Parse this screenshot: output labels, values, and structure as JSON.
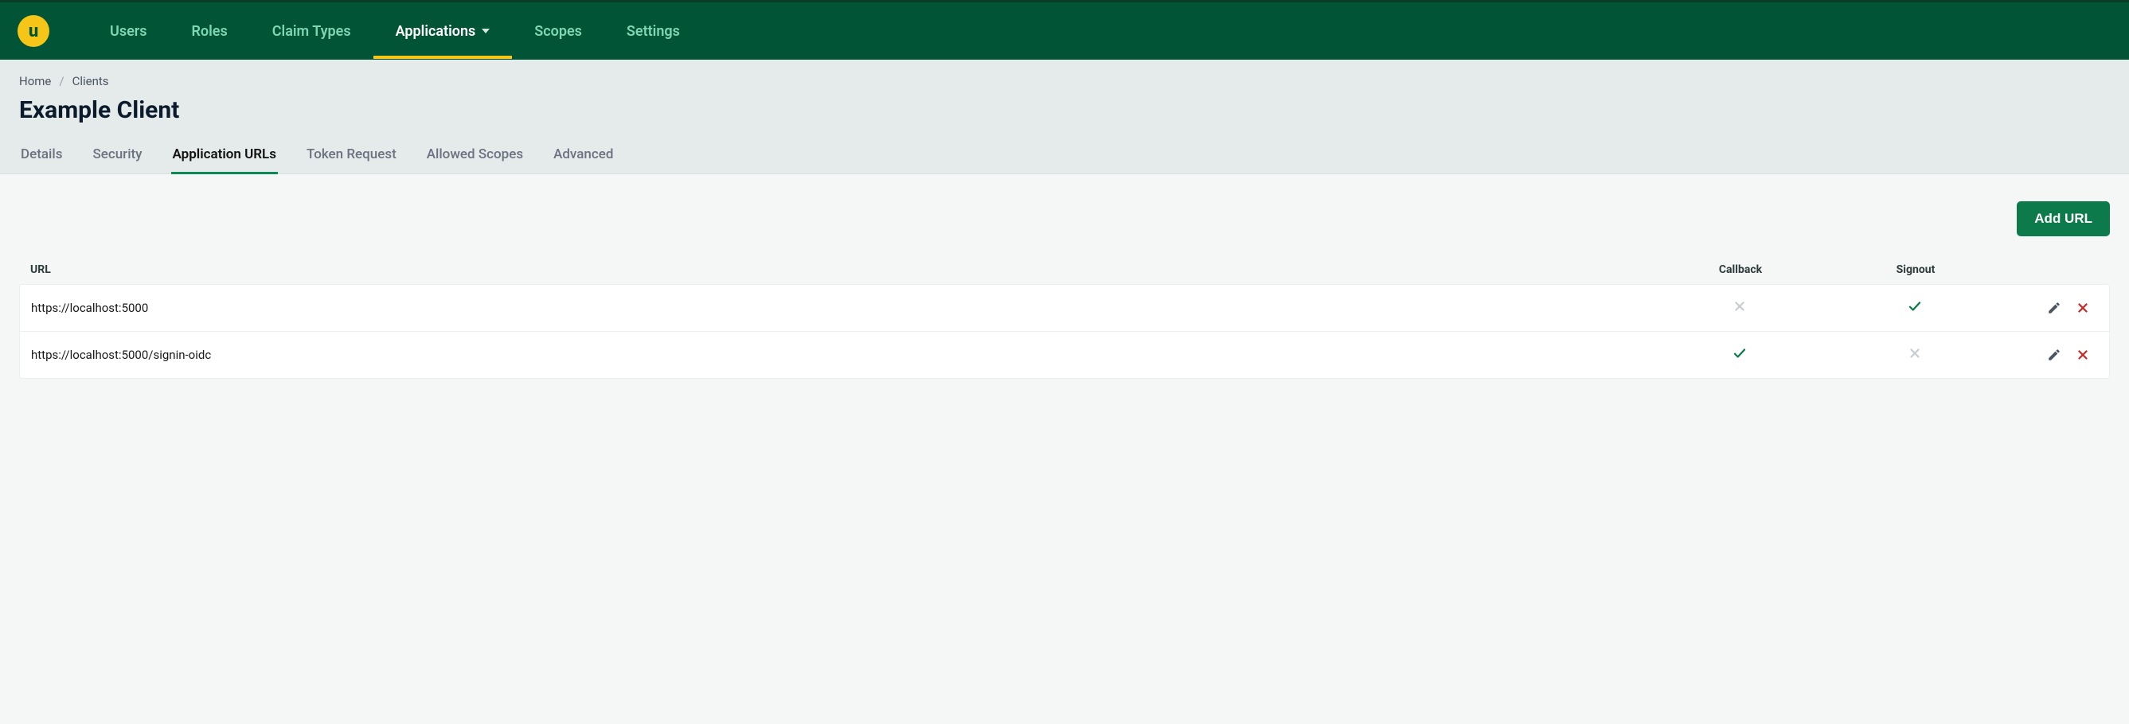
{
  "nav": {
    "items": [
      {
        "label": "Users"
      },
      {
        "label": "Roles"
      },
      {
        "label": "Claim Types"
      },
      {
        "label": "Applications",
        "active": true,
        "dropdown": true
      },
      {
        "label": "Scopes"
      },
      {
        "label": "Settings"
      }
    ]
  },
  "breadcrumb": {
    "home": "Home",
    "clients": "Clients"
  },
  "page": {
    "title": "Example Client"
  },
  "tabs": {
    "items": [
      {
        "label": "Details"
      },
      {
        "label": "Security"
      },
      {
        "label": "Application URLs",
        "active": true
      },
      {
        "label": "Token Request"
      },
      {
        "label": "Allowed Scopes"
      },
      {
        "label": "Advanced"
      }
    ]
  },
  "actions": {
    "add_url": "Add URL"
  },
  "table": {
    "headers": {
      "url": "URL",
      "callback": "Callback",
      "signout": "Signout"
    },
    "rows": [
      {
        "url": "https://localhost:5000",
        "callback": false,
        "signout": true
      },
      {
        "url": "https://localhost:5000/signin-oidc",
        "callback": true,
        "signout": false
      }
    ]
  }
}
